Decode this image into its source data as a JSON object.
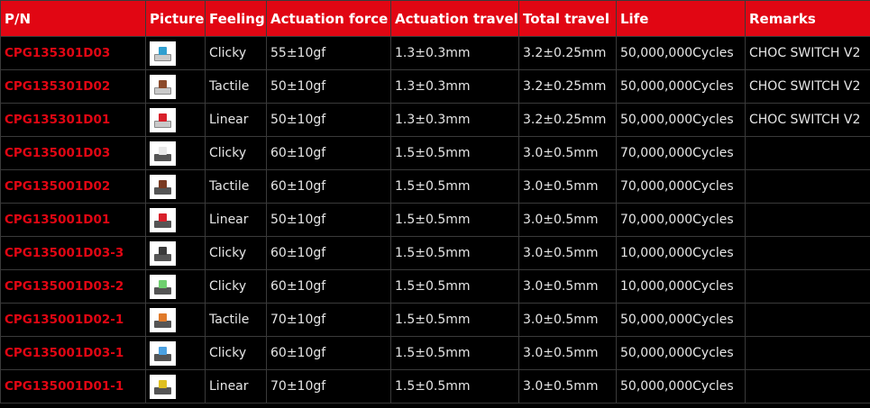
{
  "table": {
    "headers": [
      "P/N",
      "Picture",
      "Feeling",
      "Actuation force",
      "Actuation travel",
      "Total travel",
      "Life",
      "Remarks"
    ],
    "rows": [
      {
        "pn": "CPG135301D03",
        "stem_color": "#2f9fd0",
        "body": "white",
        "feeling": "Clicky",
        "force": "55±10gf",
        "act_travel": "1.3±0.3mm",
        "total_travel": "3.2±0.25mm",
        "life": "50,000,000Cycles",
        "remarks": "CHOC SWITCH V2"
      },
      {
        "pn": "CPG135301D02",
        "stem_color": "#8b4a2b",
        "body": "white",
        "feeling": "Tactile",
        "force": "50±10gf",
        "act_travel": "1.3±0.3mm",
        "total_travel": "3.2±0.25mm",
        "life": "50,000,000Cycles",
        "remarks": "CHOC SWITCH V2"
      },
      {
        "pn": "CPG135301D01",
        "stem_color": "#d8202a",
        "body": "white",
        "feeling": "Linear",
        "force": "50±10gf",
        "act_travel": "1.3±0.3mm",
        "total_travel": "3.2±0.25mm",
        "life": "50,000,000Cycles",
        "remarks": "CHOC SWITCH V2"
      },
      {
        "pn": "CPG135001D03",
        "stem_color": "#e8e8e8",
        "body": "dark",
        "feeling": "Clicky",
        "force": "60±10gf",
        "act_travel": "1.5±0.5mm",
        "total_travel": "3.0±0.5mm",
        "life": "70,000,000Cycles",
        "remarks": ""
      },
      {
        "pn": "CPG135001D02",
        "stem_color": "#7a3a22",
        "body": "dark",
        "feeling": "Tactile",
        "force": "60±10gf",
        "act_travel": "1.5±0.5mm",
        "total_travel": "3.0±0.5mm",
        "life": "70,000,000Cycles",
        "remarks": ""
      },
      {
        "pn": "CPG135001D01",
        "stem_color": "#d8202a",
        "body": "dark",
        "feeling": "Linear",
        "force": "50±10gf",
        "act_travel": "1.5±0.5mm",
        "total_travel": "3.0±0.5mm",
        "life": "70,000,000Cycles",
        "remarks": ""
      },
      {
        "pn": "CPG135001D03-3",
        "stem_color": "#3a3a3a",
        "body": "dark",
        "feeling": "Clicky",
        "force": "60±10gf",
        "act_travel": "1.5±0.5mm",
        "total_travel": "3.0±0.5mm",
        "life": "10,000,000Cycles",
        "remarks": ""
      },
      {
        "pn": "CPG135001D03-2",
        "stem_color": "#6fd06f",
        "body": "dark",
        "feeling": "Clicky",
        "force": "60±10gf",
        "act_travel": "1.5±0.5mm",
        "total_travel": "3.0±0.5mm",
        "life": "10,000,000Cycles",
        "remarks": ""
      },
      {
        "pn": "CPG135001D02-1",
        "stem_color": "#e07a2a",
        "body": "dark",
        "feeling": "Tactile",
        "force": "70±10gf",
        "act_travel": "1.5±0.5mm",
        "total_travel": "3.0±0.5mm",
        "life": "50,000,000Cycles",
        "remarks": ""
      },
      {
        "pn": "CPG135001D03-1",
        "stem_color": "#4aa0e0",
        "body": "dark",
        "feeling": "Clicky",
        "force": "60±10gf",
        "act_travel": "1.5±0.5mm",
        "total_travel": "3.0±0.5mm",
        "life": "50,000,000Cycles",
        "remarks": ""
      },
      {
        "pn": "CPG135001D01-1",
        "stem_color": "#e0c020",
        "body": "dark",
        "feeling": "Linear",
        "force": "70±10gf",
        "act_travel": "1.5±0.5mm",
        "total_travel": "3.0±0.5mm",
        "life": "50,000,000Cycles",
        "remarks": ""
      }
    ]
  },
  "colors": {
    "header_bg": "#e10613",
    "pn_text": "#e10613",
    "row_bg": "#000000"
  },
  "icons": {
    "picture": "key-switch-icon"
  }
}
